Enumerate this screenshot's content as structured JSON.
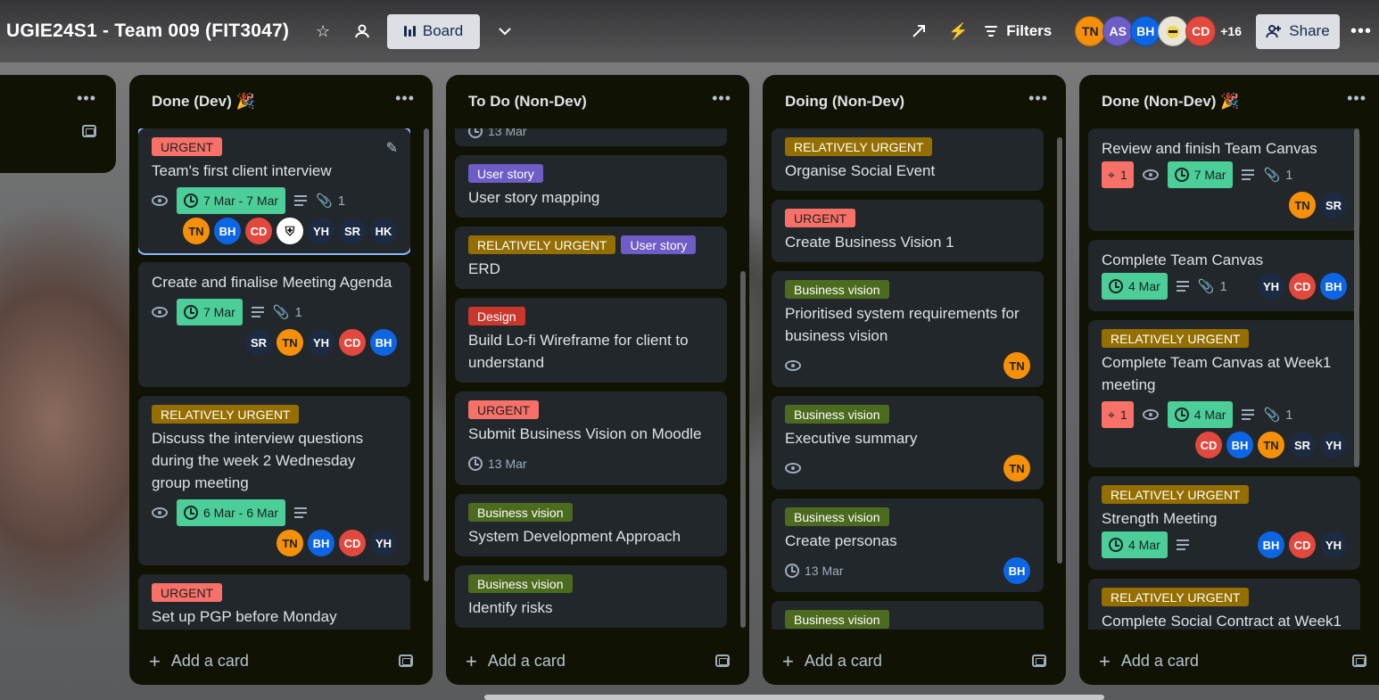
{
  "header": {
    "board_title": "UGIE24S1 - Team 009 (FIT3047)",
    "view_label": "Board",
    "filters_label": "Filters",
    "share_label": "Share",
    "more_members": "+16",
    "members": [
      {
        "initials": "TN",
        "color": "#F79009"
      },
      {
        "initials": "AS",
        "color": "#6E5DC6"
      },
      {
        "initials": "BH",
        "color": "#0C66E4"
      },
      {
        "initials": "",
        "color": "#E9E6D8"
      },
      {
        "initials": "CD",
        "color": "#E2483D"
      }
    ]
  },
  "lists": {
    "partial": {
      "name": ""
    },
    "done_dev": {
      "name": "Done (Dev) 🎉",
      "add_label": "Add a card",
      "cards": [
        {
          "label": "URGENT",
          "title": "Team's first client interview",
          "date": "7 Mar - 7 Mar",
          "attachments": "1",
          "members": [
            "TN",
            "BH",
            "CD",
            "crest",
            "YH",
            "SR",
            "HK"
          ]
        },
        {
          "title": "Create and finalise Meeting Agenda",
          "date": "7 Mar",
          "attachments": "1",
          "members": [
            "SR",
            "TN",
            "YH",
            "CD",
            "BH"
          ]
        },
        {
          "label": "RELATIVELY URGENT",
          "title": "Discuss the interview questions during the week 2 Wednesday group meeting",
          "date": "6 Mar - 6 Mar",
          "members": [
            "TN",
            "BH",
            "CD",
            "YH"
          ]
        },
        {
          "label": "URGENT",
          "title": "Set up PGP before Monday"
        }
      ]
    },
    "todo_nondev": {
      "name": "To Do (Non-Dev)",
      "add_label": "Add a card",
      "cards": [
        {
          "date": "13 Mar"
        },
        {
          "label": "User story",
          "title": "User story mapping"
        },
        {
          "label": "RELATIVELY URGENT",
          "label2": "User story",
          "title": "ERD"
        },
        {
          "label": "Design",
          "title": "Build Lo-fi Wireframe for client to understand"
        },
        {
          "label": "URGENT",
          "title": "Submit Business Vision on Moodle",
          "date": "13 Mar"
        },
        {
          "label": "Business vision",
          "title": "System Development Approach"
        },
        {
          "label": "Business vision",
          "title": "Identify risks"
        }
      ]
    },
    "doing_nondev": {
      "name": "Doing (Non-Dev)",
      "add_label": "Add a card",
      "cards": [
        {
          "label": "RELATIVELY URGENT",
          "title": "Organise Social Event"
        },
        {
          "label": "URGENT",
          "title": "Create Business Vision 1"
        },
        {
          "label": "Business vision",
          "title": "Prioritised system requirements for business vision",
          "members": [
            "TN"
          ]
        },
        {
          "label": "Business vision",
          "title": "Executive summary",
          "members": [
            "TN"
          ]
        },
        {
          "label": "Business vision",
          "title": "Create personas",
          "date": "13 Mar",
          "members": [
            "BH"
          ]
        },
        {
          "label": "Business vision"
        }
      ]
    },
    "done_nondev": {
      "name": "Done (Non-Dev) 🎉",
      "add_label": "Add a card",
      "cards": [
        {
          "title": "Review and finish Team Canvas",
          "votes": "1",
          "date": "7 Mar",
          "attachments": "1",
          "members": [
            "TN",
            "SR"
          ]
        },
        {
          "title": "Complete Team Canvas",
          "date": "4 Mar",
          "attachments": "1",
          "members": [
            "YH",
            "CD",
            "BH"
          ]
        },
        {
          "label": "RELATIVELY URGENT",
          "title": "Complete Team Canvas at Week1 meeting",
          "votes": "1",
          "date": "4 Mar",
          "attachments": "1",
          "members": [
            "CD",
            "BH",
            "TN",
            "SR",
            "YH"
          ]
        },
        {
          "label": "RELATIVELY URGENT",
          "title": "Strength Meeting",
          "date": "4 Mar",
          "members": [
            "BH",
            "CD",
            "YH"
          ]
        },
        {
          "label": "RELATIVELY URGENT",
          "title": "Complete Social Contract at Week1"
        }
      ]
    }
  }
}
